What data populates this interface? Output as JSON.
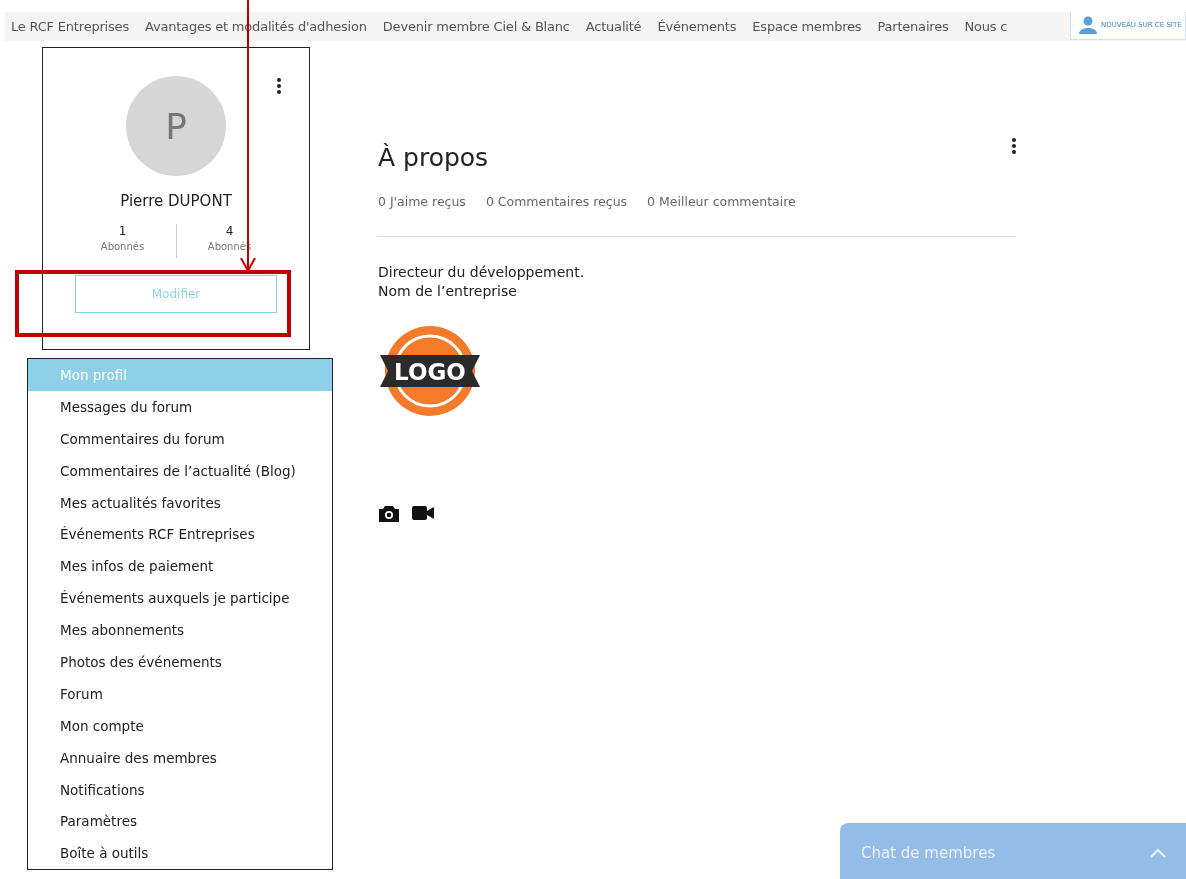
{
  "nav": {
    "items": [
      {
        "label": "Le RCF Entreprises"
      },
      {
        "label": "Avantages et modalités d'adhesion"
      },
      {
        "label": "Devenir membre Ciel & Blanc"
      },
      {
        "label": "Actualité"
      },
      {
        "label": "Événements"
      },
      {
        "label": "Espace membres"
      },
      {
        "label": "Partenaires"
      },
      {
        "label": "Nous c"
      }
    ],
    "login": {
      "label": "NOUVEAU SUR CE SITE"
    }
  },
  "profile": {
    "initial": "P",
    "name": "Pierre DUPONT",
    "stats": [
      {
        "value": "1",
        "label": "Abonnés"
      },
      {
        "value": "4",
        "label": "Abonnés"
      }
    ],
    "edit_button": "Modifier"
  },
  "menu": [
    {
      "label": "Mon profil",
      "selected": true
    },
    {
      "label": "Messages du forum",
      "selected": false
    },
    {
      "label": "Commentaires du forum",
      "selected": false
    },
    {
      "label": "Commentaires de l’actualité (Blog)",
      "selected": false
    },
    {
      "label": "Mes actualités favorites",
      "selected": false
    },
    {
      "label": "Événements RCF Entreprises",
      "selected": false
    },
    {
      "label": "Mes infos de paiement",
      "selected": false
    },
    {
      "label": "Événements auxquels je participe",
      "selected": false
    },
    {
      "label": "Mes abonnements",
      "selected": false
    },
    {
      "label": "Photos des événements",
      "selected": false
    },
    {
      "label": "Forum",
      "selected": false
    },
    {
      "label": "Mon compte",
      "selected": false
    },
    {
      "label": "Annuaire des membres",
      "selected": false
    },
    {
      "label": "Notifications",
      "selected": false
    },
    {
      "label": "Paramètres",
      "selected": false
    },
    {
      "label": "Boîte à outils",
      "selected": false
    }
  ],
  "about": {
    "title": "À propos",
    "stats": [
      "0 J'aime reçus",
      "0 Commentaires reçus",
      "0 Meilleur commentaire"
    ],
    "bio": [
      "Directeur du développement.",
      "Nom de l’entreprise"
    ],
    "logo_text": "LOGO"
  },
  "chat": {
    "title": "Chat de membres"
  }
}
